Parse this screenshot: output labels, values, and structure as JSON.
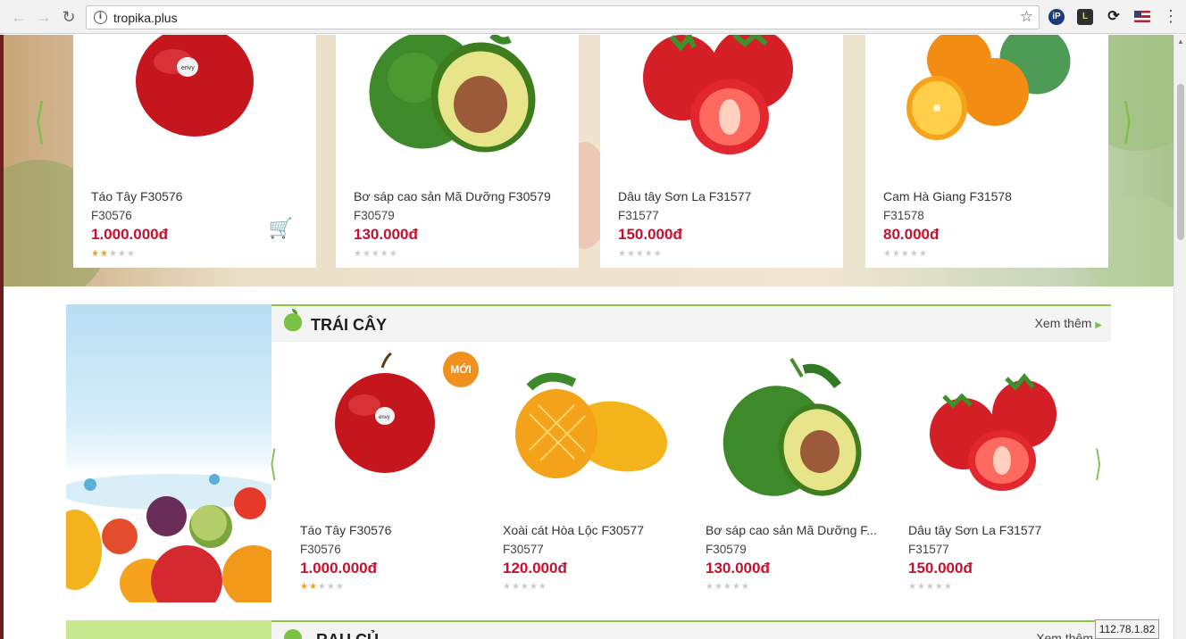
{
  "browser": {
    "url": "tropika.plus",
    "extensions": [
      {
        "icon": "ip-extension-icon",
        "label": "iP",
        "color": "#1a3a7a"
      },
      {
        "icon": "l-extension-icon",
        "label": "L",
        "color": "#2f2f2f"
      },
      {
        "icon": "sync-extension-icon",
        "label": "",
        "color": "#1f1f1f"
      },
      {
        "icon": "us-flag-icon",
        "label": "",
        "color": "#b22234"
      }
    ]
  },
  "banner_products": [
    {
      "name": "Táo Tây F30576",
      "code": "F30576",
      "price": "1.000.000đ",
      "rating": 1.5
    },
    {
      "name": "Bơ sáp cao sản Mã Dưỡng F30579",
      "code": "F30579",
      "price": "130.000đ",
      "rating": 0
    },
    {
      "name": "Dâu tây Sơn La F31577",
      "code": "F31577",
      "price": "150.000đ",
      "rating": 0
    },
    {
      "name": "Cam Hà Giang F31578",
      "code": "F31578",
      "price": "80.000đ",
      "rating": 0
    }
  ],
  "fruit_section": {
    "title": "TRÁI CÂY",
    "more_label": "Xem thêm",
    "new_badge": "MỚI",
    "products": [
      {
        "name": "Táo Tây F30576",
        "code": "F30576",
        "price": "1.000.000đ",
        "rating": 1.5
      },
      {
        "name": "Xoài cát Hòa Lộc F30577",
        "code": "F30577",
        "price": "120.000đ",
        "rating": 0
      },
      {
        "name": "Bơ sáp cao sản Mã Dưỡng F...",
        "code": "F30579",
        "price": "130.000đ",
        "rating": 0
      },
      {
        "name": "Dâu tây Sơn La F31577",
        "code": "F31577",
        "price": "150.000đ",
        "rating": 0
      }
    ]
  },
  "veg_section": {
    "title": "RAU CỦ",
    "more_label": "Xem thêm"
  },
  "ip_tooltip": "112.78.1.82",
  "colors": {
    "accent_green": "#8dc63f",
    "price_red": "#c8102e",
    "badge_orange": "#f0901e"
  }
}
